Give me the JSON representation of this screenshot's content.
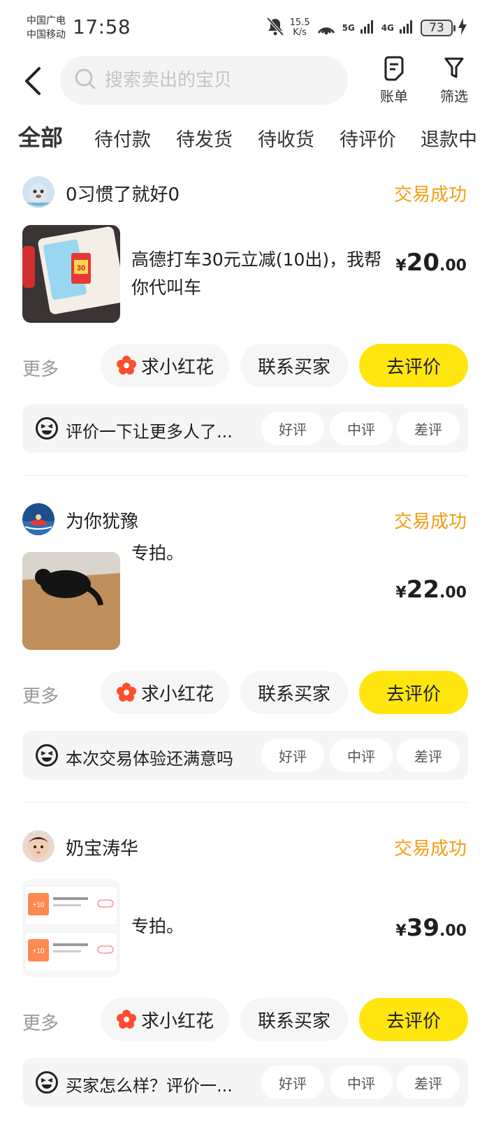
{
  "status_bar": {
    "carrier1": "中国广电",
    "carrier2": "中国移动",
    "time": "17:58",
    "net_speed_value": "15.5",
    "net_speed_unit": "K/s",
    "signal1_label": "5G",
    "signal2_label": "4G",
    "battery": "73"
  },
  "header": {
    "search_placeholder": "搜索卖出的宝贝",
    "bill_label": "账单",
    "filter_label": "筛选"
  },
  "tabs": [
    {
      "label": "全部",
      "active": true
    },
    {
      "label": "待付款"
    },
    {
      "label": "待发货"
    },
    {
      "label": "待收货"
    },
    {
      "label": "待评价"
    },
    {
      "label": "退款中"
    }
  ],
  "orders": [
    {
      "buyer": "0习惯了就好0",
      "status": "交易成功",
      "title": "高德打车30元立减(10出)，我帮你代叫车",
      "price_currency": "¥",
      "price_int": "20",
      "price_dec": ".00",
      "more": "更多",
      "flower_btn": "求小红花",
      "contact_btn": "联系买家",
      "review_btn": "去评价",
      "rate_prompt": "评价一下让更多人了...",
      "rate_good": "好评",
      "rate_mid": "中评",
      "rate_bad": "差评"
    },
    {
      "buyer": "为你犹豫",
      "status": "交易成功",
      "title": "专拍。",
      "price_currency": "¥",
      "price_int": "22",
      "price_dec": ".00",
      "more": "更多",
      "flower_btn": "求小红花",
      "contact_btn": "联系买家",
      "review_btn": "去评价",
      "rate_prompt": "本次交易体验还满意吗",
      "rate_good": "好评",
      "rate_mid": "中评",
      "rate_bad": "差评"
    },
    {
      "buyer": "奶宝涛华",
      "status": "交易成功",
      "title": "专拍。",
      "price_currency": "¥",
      "price_int": "39",
      "price_dec": ".00",
      "more": "更多",
      "flower_btn": "求小红花",
      "contact_btn": "联系买家",
      "review_btn": "去评价",
      "rate_prompt": "买家怎么样？评价一...",
      "rate_good": "好评",
      "rate_mid": "中评",
      "rate_bad": "差评"
    }
  ],
  "thumb1_text": {
    "badge": "30"
  },
  "thumb3_text": {
    "row1": "+10",
    "row2": "+10"
  },
  "colors": {
    "accent_yellow": "#ffe60f",
    "status_orange": "#f39c12",
    "flower_red": "#ff4d2e"
  }
}
